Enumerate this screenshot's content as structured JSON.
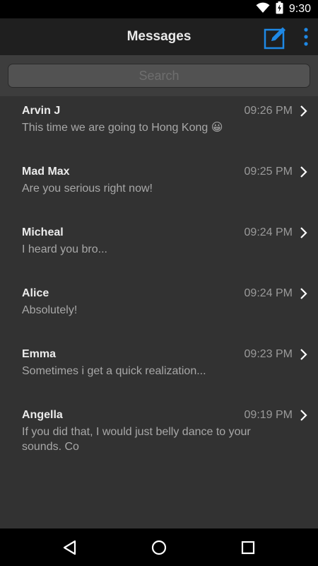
{
  "status_bar": {
    "time": "9:30",
    "icons": [
      "wifi-icon",
      "battery-charging-icon"
    ]
  },
  "header": {
    "title": "Messages",
    "compose_icon": "compose-icon",
    "more_icon": "more-vertical-icon",
    "accent_color": "#1e88e5"
  },
  "search": {
    "placeholder": "Search",
    "value": ""
  },
  "conversations": [
    {
      "name": "Arvin J",
      "time": "09:26 PM",
      "preview": "This time we are going to Hong Kong 😀"
    },
    {
      "name": "Mad Max",
      "time": "09:25 PM",
      "preview": "Are you serious right now!"
    },
    {
      "name": "Micheal",
      "time": "09:24 PM",
      "preview": "I heard you bro..."
    },
    {
      "name": "Alice",
      "time": "09:24 PM",
      "preview": "Absolutely!"
    },
    {
      "name": "Emma",
      "time": "09:23 PM",
      "preview": "Sometimes i get a quick realization..."
    },
    {
      "name": "Angella",
      "time": "09:19 PM",
      "preview": "If you did that, I would just belly dance to your sounds. Co"
    }
  ],
  "nav_bar": {
    "icons": [
      "back-icon",
      "home-icon",
      "recents-icon"
    ]
  }
}
